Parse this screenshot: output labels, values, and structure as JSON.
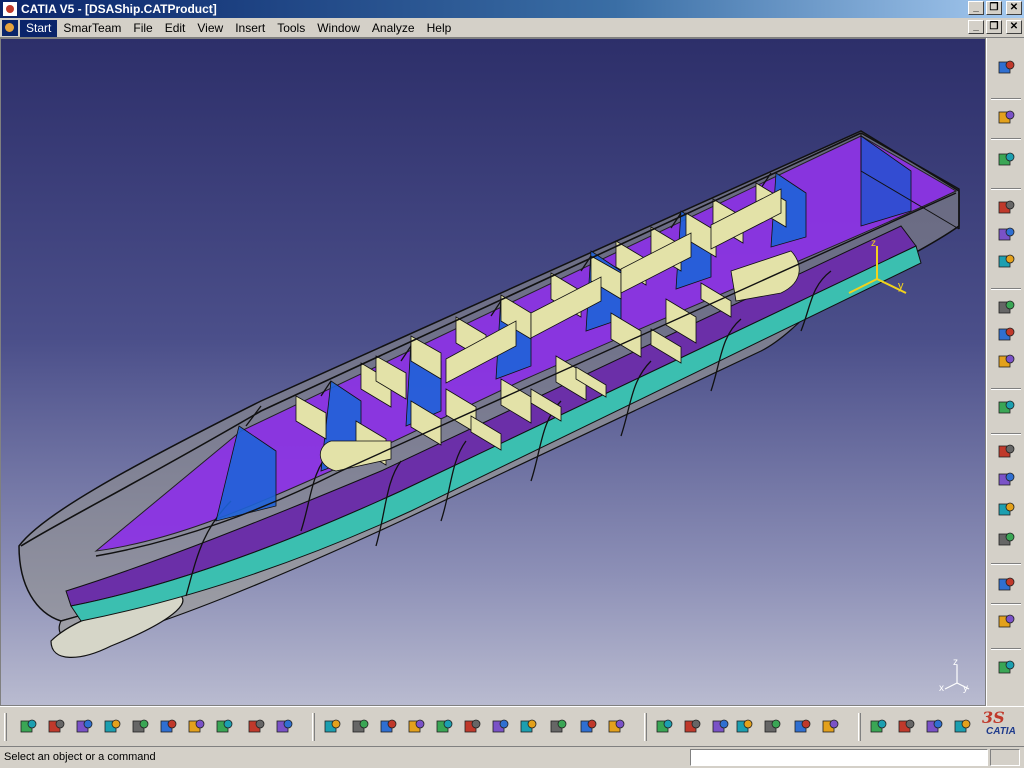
{
  "window": {
    "title": "CATIA V5 - [DSAShip.CATProduct]"
  },
  "menu": {
    "items": [
      "Start",
      "SmarTeam",
      "File",
      "Edit",
      "View",
      "Insert",
      "Tools",
      "Window",
      "Analyze",
      "Help"
    ],
    "active": "Start"
  },
  "viewport": {
    "axis_labels": {
      "x": "x",
      "y": "y",
      "z": "z"
    },
    "colors": {
      "bg_top": "#2d2f6a",
      "bg_bottom": "#b9bbd0",
      "deck": "#8c2fe8",
      "bulkhead_blue": "#1e63d8",
      "bulkhead_cream": "#e3e2a8",
      "stripe_purple": "#6b2fa8",
      "stripe_teal": "#3bbfb0",
      "hull": "#8f8f8a",
      "axis": "#f2d21c"
    }
  },
  "right_toolbar": {
    "icons": [
      "compass-icon",
      "select-arrow-icon",
      "fly-icon",
      "snap-icon",
      "manipulate-icon",
      "product-structure-icon",
      "assembly-constraint-icon",
      "stack-parts-icon",
      "stack-sheets-icon",
      "reorder-icon",
      "section-icon",
      "align-icon",
      "bounding-box-icon",
      "camera-icon",
      "clash-icon",
      "spiral-icon",
      "document-icon"
    ]
  },
  "bottom_toolbar": {
    "icons": [
      "new-icon",
      "open-icon",
      "save-icon",
      "print-icon",
      "cut-icon",
      "copy-icon",
      "paste-icon",
      "undo-icon",
      "redo-icon",
      "whats-this-icon",
      "fly-mode-icon",
      "fit-all-icon",
      "pan-icon",
      "rotate-icon",
      "zoom-in-icon",
      "zoom-out-icon",
      "normal-view-icon",
      "iso-view-icon",
      "render-style-icon",
      "hide-show-icon",
      "swap-visible-icon",
      "formula-icon",
      "comment-icon",
      "knowledge-icon",
      "table-icon",
      "tree-icon",
      "lock-icon",
      "parameter-icon",
      "measure-icon",
      "analysis-icon",
      "weight-icon",
      "plug-icon"
    ]
  },
  "branding": {
    "ds": "3S",
    "name": "CATIA"
  },
  "status": {
    "message": "Select an object or a command",
    "input_value": ""
  }
}
